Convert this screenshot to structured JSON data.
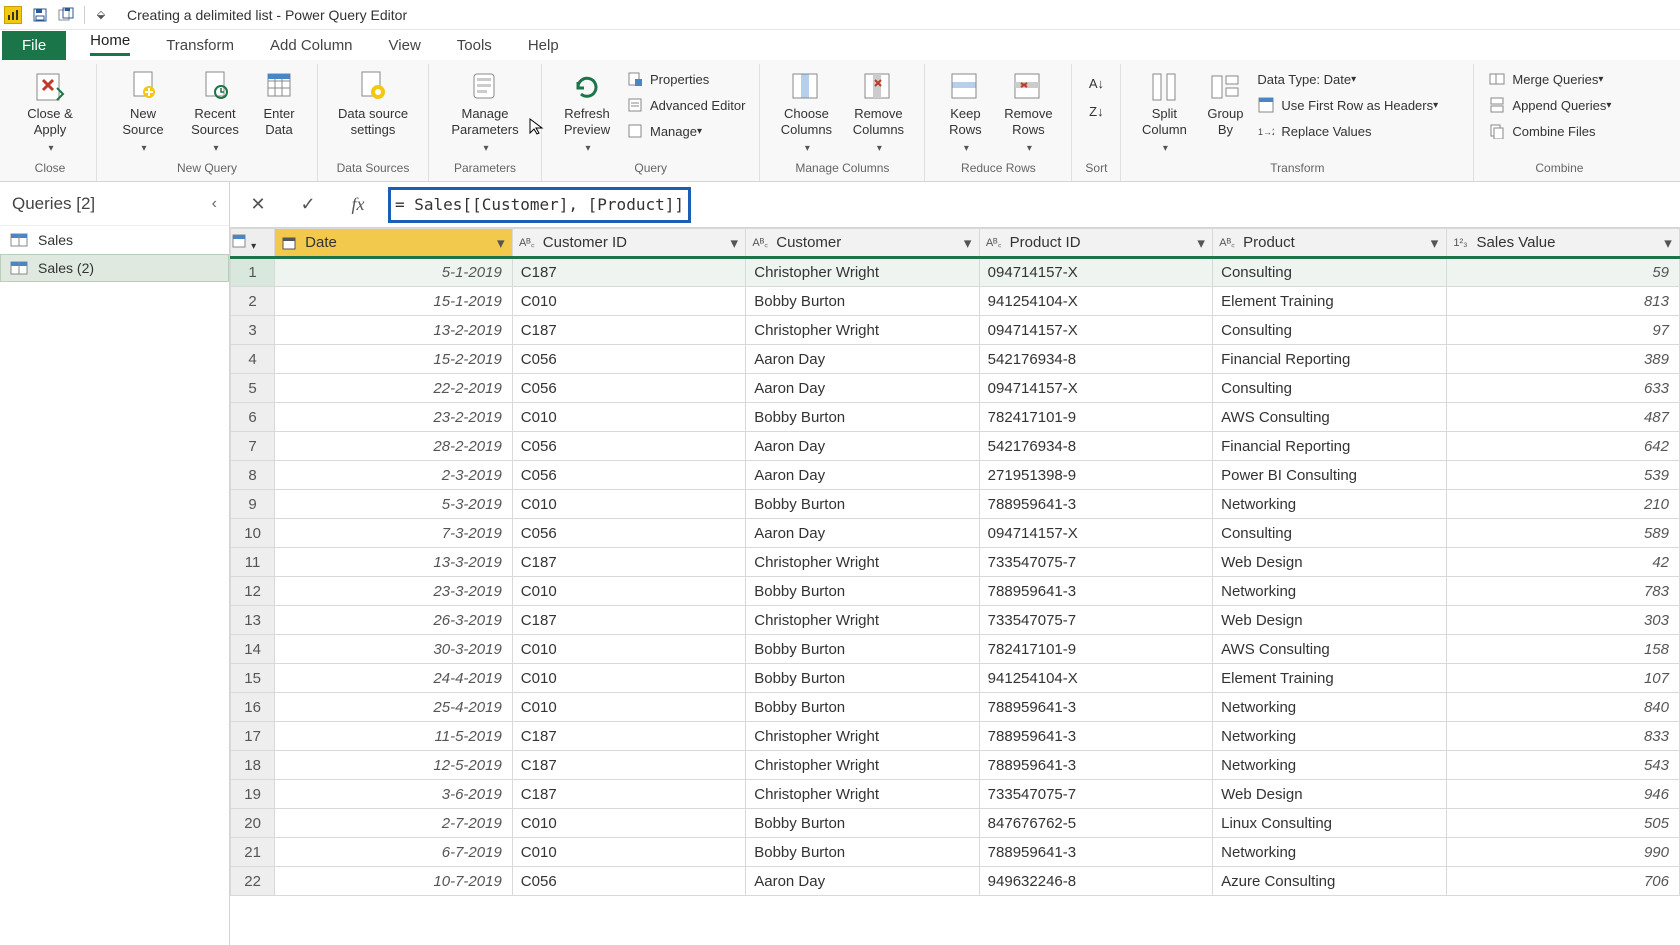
{
  "titlebar": {
    "title": "Creating a delimited list - Power Query Editor"
  },
  "tabs": {
    "file": "File",
    "items": [
      "Home",
      "Transform",
      "Add Column",
      "View",
      "Tools",
      "Help"
    ],
    "activeIndex": 0
  },
  "ribbon": {
    "close": {
      "closeApply": "Close &\nApply",
      "group": "Close"
    },
    "newQuery": {
      "newSource": "New\nSource",
      "recentSources": "Recent\nSources",
      "enterData": "Enter\nData",
      "group": "New Query"
    },
    "dataSources": {
      "btn": "Data source\nsettings",
      "group": "Data Sources"
    },
    "parameters": {
      "btn": "Manage\nParameters",
      "group": "Parameters"
    },
    "query": {
      "refresh": "Refresh\nPreview",
      "properties": "Properties",
      "advanced": "Advanced Editor",
      "manage": "Manage",
      "group": "Query"
    },
    "manageColumns": {
      "choose": "Choose\nColumns",
      "remove": "Remove\nColumns",
      "group": "Manage Columns"
    },
    "reduceRows": {
      "keep": "Keep\nRows",
      "remove": "Remove\nRows",
      "group": "Reduce Rows"
    },
    "sort": {
      "group": "Sort"
    },
    "transform": {
      "split": "Split\nColumn",
      "groupBy": "Group\nBy",
      "dataType": "Data Type: Date",
      "firstRow": "Use First Row as Headers",
      "replace": "Replace Values",
      "group": "Transform"
    },
    "combine": {
      "merge": "Merge Queries",
      "append": "Append Queries",
      "combine": "Combine Files",
      "group": "Combine"
    }
  },
  "queriesPane": {
    "header": "Queries [2]",
    "items": [
      {
        "name": "Sales"
      },
      {
        "name": "Sales (2)"
      }
    ],
    "selectedIndex": 1
  },
  "formulaBar": {
    "value": "= Sales[[Customer], [Product]]"
  },
  "grid": {
    "columns": [
      {
        "name": "Date",
        "type": "date",
        "selected": true
      },
      {
        "name": "Customer ID",
        "type": "text"
      },
      {
        "name": "Customer",
        "type": "text"
      },
      {
        "name": "Product ID",
        "type": "text"
      },
      {
        "name": "Product",
        "type": "text"
      },
      {
        "name": "Sales Value",
        "type": "number"
      }
    ],
    "rows": [
      {
        "n": 1,
        "date": "5-1-2019",
        "cid": "C187",
        "cust": "Christopher Wright",
        "pid": "094714157-X",
        "prod": "Consulting",
        "val": 59
      },
      {
        "n": 2,
        "date": "15-1-2019",
        "cid": "C010",
        "cust": "Bobby Burton",
        "pid": "941254104-X",
        "prod": "Element Training",
        "val": 813
      },
      {
        "n": 3,
        "date": "13-2-2019",
        "cid": "C187",
        "cust": "Christopher Wright",
        "pid": "094714157-X",
        "prod": "Consulting",
        "val": 97
      },
      {
        "n": 4,
        "date": "15-2-2019",
        "cid": "C056",
        "cust": "Aaron Day",
        "pid": "542176934-8",
        "prod": "Financial Reporting",
        "val": 389
      },
      {
        "n": 5,
        "date": "22-2-2019",
        "cid": "C056",
        "cust": "Aaron Day",
        "pid": "094714157-X",
        "prod": "Consulting",
        "val": 633
      },
      {
        "n": 6,
        "date": "23-2-2019",
        "cid": "C010",
        "cust": "Bobby Burton",
        "pid": "782417101-9",
        "prod": "AWS Consulting",
        "val": 487
      },
      {
        "n": 7,
        "date": "28-2-2019",
        "cid": "C056",
        "cust": "Aaron Day",
        "pid": "542176934-8",
        "prod": "Financial Reporting",
        "val": 642
      },
      {
        "n": 8,
        "date": "2-3-2019",
        "cid": "C056",
        "cust": "Aaron Day",
        "pid": "271951398-9",
        "prod": "Power BI Consulting",
        "val": 539
      },
      {
        "n": 9,
        "date": "5-3-2019",
        "cid": "C010",
        "cust": "Bobby Burton",
        "pid": "788959641-3",
        "prod": "Networking",
        "val": 210
      },
      {
        "n": 10,
        "date": "7-3-2019",
        "cid": "C056",
        "cust": "Aaron Day",
        "pid": "094714157-X",
        "prod": "Consulting",
        "val": 589
      },
      {
        "n": 11,
        "date": "13-3-2019",
        "cid": "C187",
        "cust": "Christopher Wright",
        "pid": "733547075-7",
        "prod": "Web Design",
        "val": 42
      },
      {
        "n": 12,
        "date": "23-3-2019",
        "cid": "C010",
        "cust": "Bobby Burton",
        "pid": "788959641-3",
        "prod": "Networking",
        "val": 783
      },
      {
        "n": 13,
        "date": "26-3-2019",
        "cid": "C187",
        "cust": "Christopher Wright",
        "pid": "733547075-7",
        "prod": "Web Design",
        "val": 303
      },
      {
        "n": 14,
        "date": "30-3-2019",
        "cid": "C010",
        "cust": "Bobby Burton",
        "pid": "782417101-9",
        "prod": "AWS Consulting",
        "val": 158
      },
      {
        "n": 15,
        "date": "24-4-2019",
        "cid": "C010",
        "cust": "Bobby Burton",
        "pid": "941254104-X",
        "prod": "Element Training",
        "val": 107
      },
      {
        "n": 16,
        "date": "25-4-2019",
        "cid": "C010",
        "cust": "Bobby Burton",
        "pid": "788959641-3",
        "prod": "Networking",
        "val": 840
      },
      {
        "n": 17,
        "date": "11-5-2019",
        "cid": "C187",
        "cust": "Christopher Wright",
        "pid": "788959641-3",
        "prod": "Networking",
        "val": 833
      },
      {
        "n": 18,
        "date": "12-5-2019",
        "cid": "C187",
        "cust": "Christopher Wright",
        "pid": "788959641-3",
        "prod": "Networking",
        "val": 543
      },
      {
        "n": 19,
        "date": "3-6-2019",
        "cid": "C187",
        "cust": "Christopher Wright",
        "pid": "733547075-7",
        "prod": "Web Design",
        "val": 946
      },
      {
        "n": 20,
        "date": "2-7-2019",
        "cid": "C010",
        "cust": "Bobby Burton",
        "pid": "847676762-5",
        "prod": "Linux Consulting",
        "val": 505
      },
      {
        "n": 21,
        "date": "6-7-2019",
        "cid": "C010",
        "cust": "Bobby Burton",
        "pid": "788959641-3",
        "prod": "Networking",
        "val": 990
      },
      {
        "n": 22,
        "date": "10-7-2019",
        "cid": "C056",
        "cust": "Aaron Day",
        "pid": "949632246-8",
        "prod": "Azure Consulting",
        "val": 706
      }
    ],
    "selectedRowIndex": 0
  }
}
